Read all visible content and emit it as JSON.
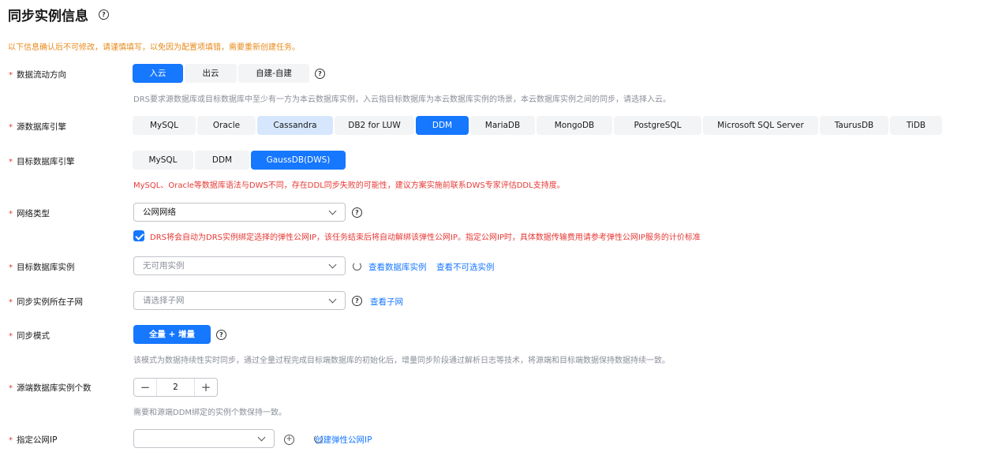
{
  "page": {
    "title": "同步实例信息",
    "notice": "以下信息确认后不可修改，请谨慎填写，以免因为配置项填错，需要重新创建任务。"
  },
  "flow": {
    "label": "数据流动方向",
    "options": [
      "入云",
      "出云",
      "自建-自建"
    ],
    "selected": "入云",
    "hint": "DRS要求源数据库或目标数据库中至少有一方为本云数据库实例，入云指目标数据库为本云数据库实例的场景，本云数据库实例之间的同步，请选择入云。"
  },
  "source_engine": {
    "label": "源数据库引擎",
    "options": [
      "MySQL",
      "Oracle",
      "Cassandra",
      "DB2 for LUW",
      "DDM",
      "MariaDB",
      "MongoDB",
      "PostgreSQL",
      "Microsoft SQL Server",
      "TaurusDB",
      "TiDB"
    ],
    "selected": "DDM",
    "hovered": "Cassandra"
  },
  "target_engine": {
    "label": "目标数据库引擎",
    "options": [
      "MySQL",
      "DDM",
      "GaussDB(DWS)"
    ],
    "selected": "GaussDB(DWS)",
    "warning": "MySQL、Oracle等数据库语法与DWS不同，存在DDL同步失败的可能性，建议方案实施前联系DWS专家评估DDL支持度。"
  },
  "network": {
    "label": "网络类型",
    "value": "公网网络",
    "checkbox_checked": true,
    "checkbox_text": "DRS将会自动为DRS实例绑定选择的弹性公网IP，该任务结束后将自动解绑该弹性公网IP。指定公网IP时，具体数据传输费用请参考弹性公网IP服务的计价标准"
  },
  "target_instance": {
    "label": "目标数据库实例",
    "placeholder": "无可用实例",
    "link1": "查看数据库实例",
    "link2": "查看不可选实例"
  },
  "subnet": {
    "label": "同步实例所在子网",
    "placeholder": "请选择子网",
    "link": "查看子网"
  },
  "sync_mode": {
    "label": "同步模式",
    "button": "全量 + 增量",
    "hint": "该模式为数据持续性实时同步，通过全量过程完成目标端数据库的初始化后，增量同步阶段通过解析日志等技术，将源端和目标端数据保持数据持续一致。"
  },
  "instance_count": {
    "label": "源端数据库实例个数",
    "value": "2",
    "hint": "需要和源端DDM绑定的实例个数保持一致。"
  },
  "public_ip": {
    "label": "指定公网IP",
    "value": "",
    "link": "创建弹性公网IP"
  }
}
